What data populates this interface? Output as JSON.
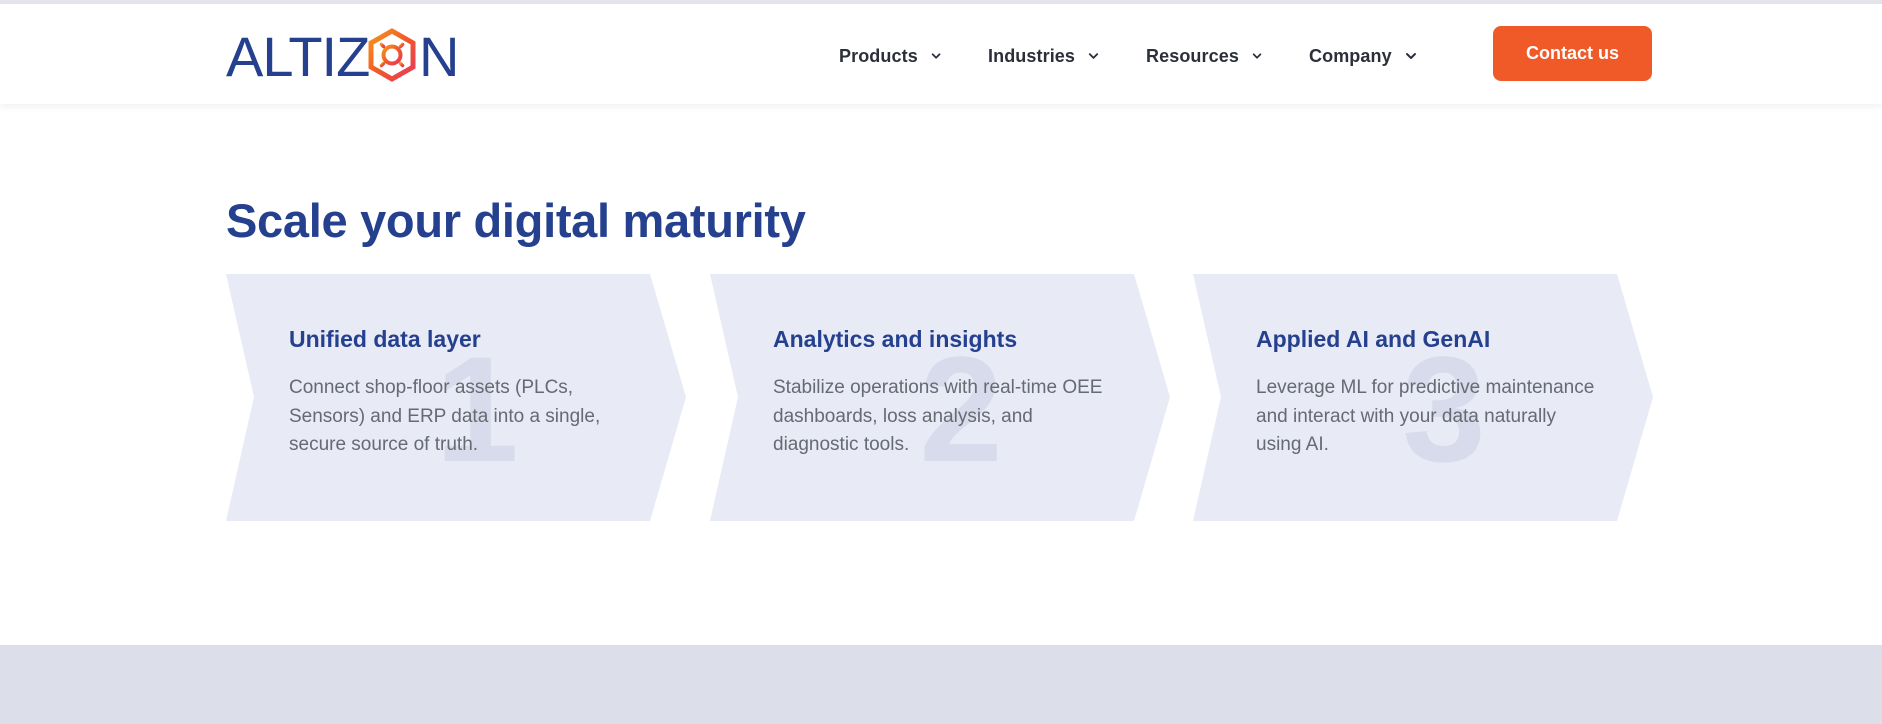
{
  "brand": {
    "name": "ALTIZON",
    "logo_text_left": "ALTIZ",
    "logo_text_right": "N",
    "primary_color": "#24408e",
    "accent_color": "#f05a28",
    "logo_gradient": [
      "#f0592a",
      "#e8395f"
    ]
  },
  "nav": {
    "items": [
      {
        "label": "Products",
        "icon": "chevron-down-icon"
      },
      {
        "label": "Industries",
        "icon": "chevron-down-icon"
      },
      {
        "label": "Resources",
        "icon": "chevron-down-icon"
      },
      {
        "label": "Company",
        "icon": "chevron-down-icon"
      }
    ],
    "cta_label": "Contact us"
  },
  "section": {
    "title": "Scale your digital maturity",
    "cards": [
      {
        "number": "1",
        "title": "Unified data layer",
        "text": "Connect shop-floor assets (PLCs, Sensors) and ERP data into a single, secure source of truth."
      },
      {
        "number": "2",
        "title": "Analytics and insights",
        "text": "Stabilize operations with real-time OEE dashboards, loss analysis, and diagnostic tools."
      },
      {
        "number": "3",
        "title": "Applied AI and GenAI",
        "text": "Leverage ML for predictive maintenance and interact with your data naturally using AI."
      }
    ],
    "card_fill": "#e8eaf5"
  }
}
